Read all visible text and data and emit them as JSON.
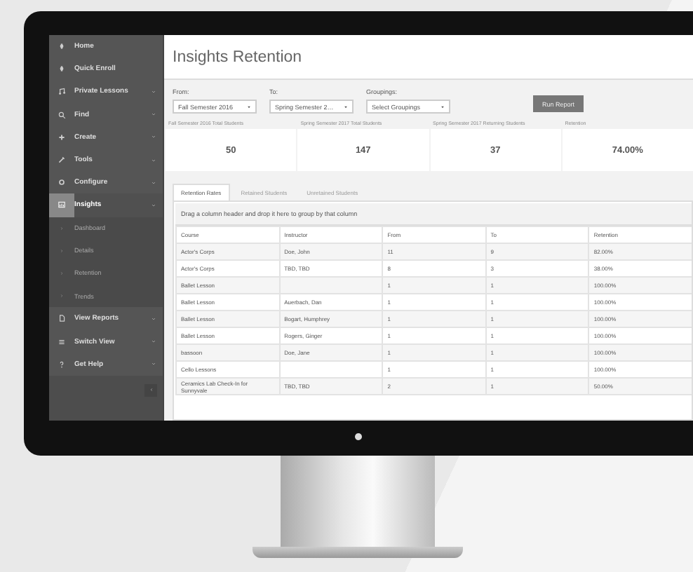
{
  "sidebar": {
    "items": [
      {
        "label": "Home",
        "kind": "link",
        "selected": false
      },
      {
        "label": "Quick Enroll",
        "kind": "link",
        "selected": false
      },
      {
        "label": "Private Lessons",
        "kind": "menu",
        "selected": false
      },
      {
        "label": "Find",
        "kind": "menu",
        "selected": false
      },
      {
        "label": "Create",
        "kind": "menu",
        "selected": false
      },
      {
        "label": "Tools",
        "kind": "menu",
        "selected": false
      },
      {
        "label": "Configure",
        "kind": "menu",
        "selected": false
      },
      {
        "label": "Insights",
        "kind": "menu",
        "selected": true,
        "children": [
          {
            "label": "Dashboard"
          },
          {
            "label": "Details"
          },
          {
            "label": "Retention"
          },
          {
            "label": "Trends"
          }
        ]
      },
      {
        "label": "View Reports",
        "kind": "menu",
        "selected": false
      },
      {
        "label": "Switch View",
        "kind": "menu",
        "selected": false
      },
      {
        "label": "Get Help",
        "kind": "menu",
        "selected": false
      }
    ]
  },
  "page": {
    "title": "Insights Retention"
  },
  "filters": [
    {
      "label": "From:",
      "value": "Fall Semester 2016"
    },
    {
      "label": "To:",
      "value": "Spring Semester 2…"
    },
    {
      "label": "Groupings:",
      "value": "Select Groupings"
    }
  ],
  "run_button": "Run Report",
  "stats": [
    {
      "label": "Fall Semester 2016 Total Students",
      "value": "50"
    },
    {
      "label": "Spring Semester 2017 Total Students",
      "value": "147"
    },
    {
      "label": "Spring Semester 2017 Returning Students",
      "value": "37"
    },
    {
      "label": "Retention",
      "value": "74.00%"
    }
  ],
  "tabs": [
    {
      "label": "Retention Rates",
      "selected": true
    },
    {
      "label": "Retained Students",
      "selected": false
    },
    {
      "label": "Unretained Students",
      "selected": false
    }
  ],
  "group_hint": "Drag a column header and drop it here to group by that column",
  "table": {
    "columns": [
      "Course",
      "Instructor",
      "From",
      "To",
      "Retention"
    ],
    "rows": [
      [
        "Actor's Corps",
        "Doe, John",
        "11",
        "9",
        "82.00%"
      ],
      [
        "Actor's Corps",
        "TBD, TBD",
        "8",
        "3",
        "38.00%"
      ],
      [
        "Ballet Lesson",
        "",
        "1",
        "1",
        "100.00%"
      ],
      [
        "Ballet Lesson",
        "Auerbach, Dan",
        "1",
        "1",
        "100.00%"
      ],
      [
        "Ballet Lesson",
        "Bogart, Humphrey",
        "1",
        "1",
        "100.00%"
      ],
      [
        "Ballet Lesson",
        "Rogers, Ginger",
        "1",
        "1",
        "100.00%"
      ],
      [
        "bassoon",
        "Doe, Jane",
        "1",
        "1",
        "100.00%"
      ],
      [
        "Cello Lessons",
        "",
        "1",
        "1",
        "100.00%"
      ],
      [
        "Ceramics Lab Check-In for Sunnyvale",
        "TBD, TBD",
        "2",
        "1",
        "50.00%"
      ]
    ]
  }
}
